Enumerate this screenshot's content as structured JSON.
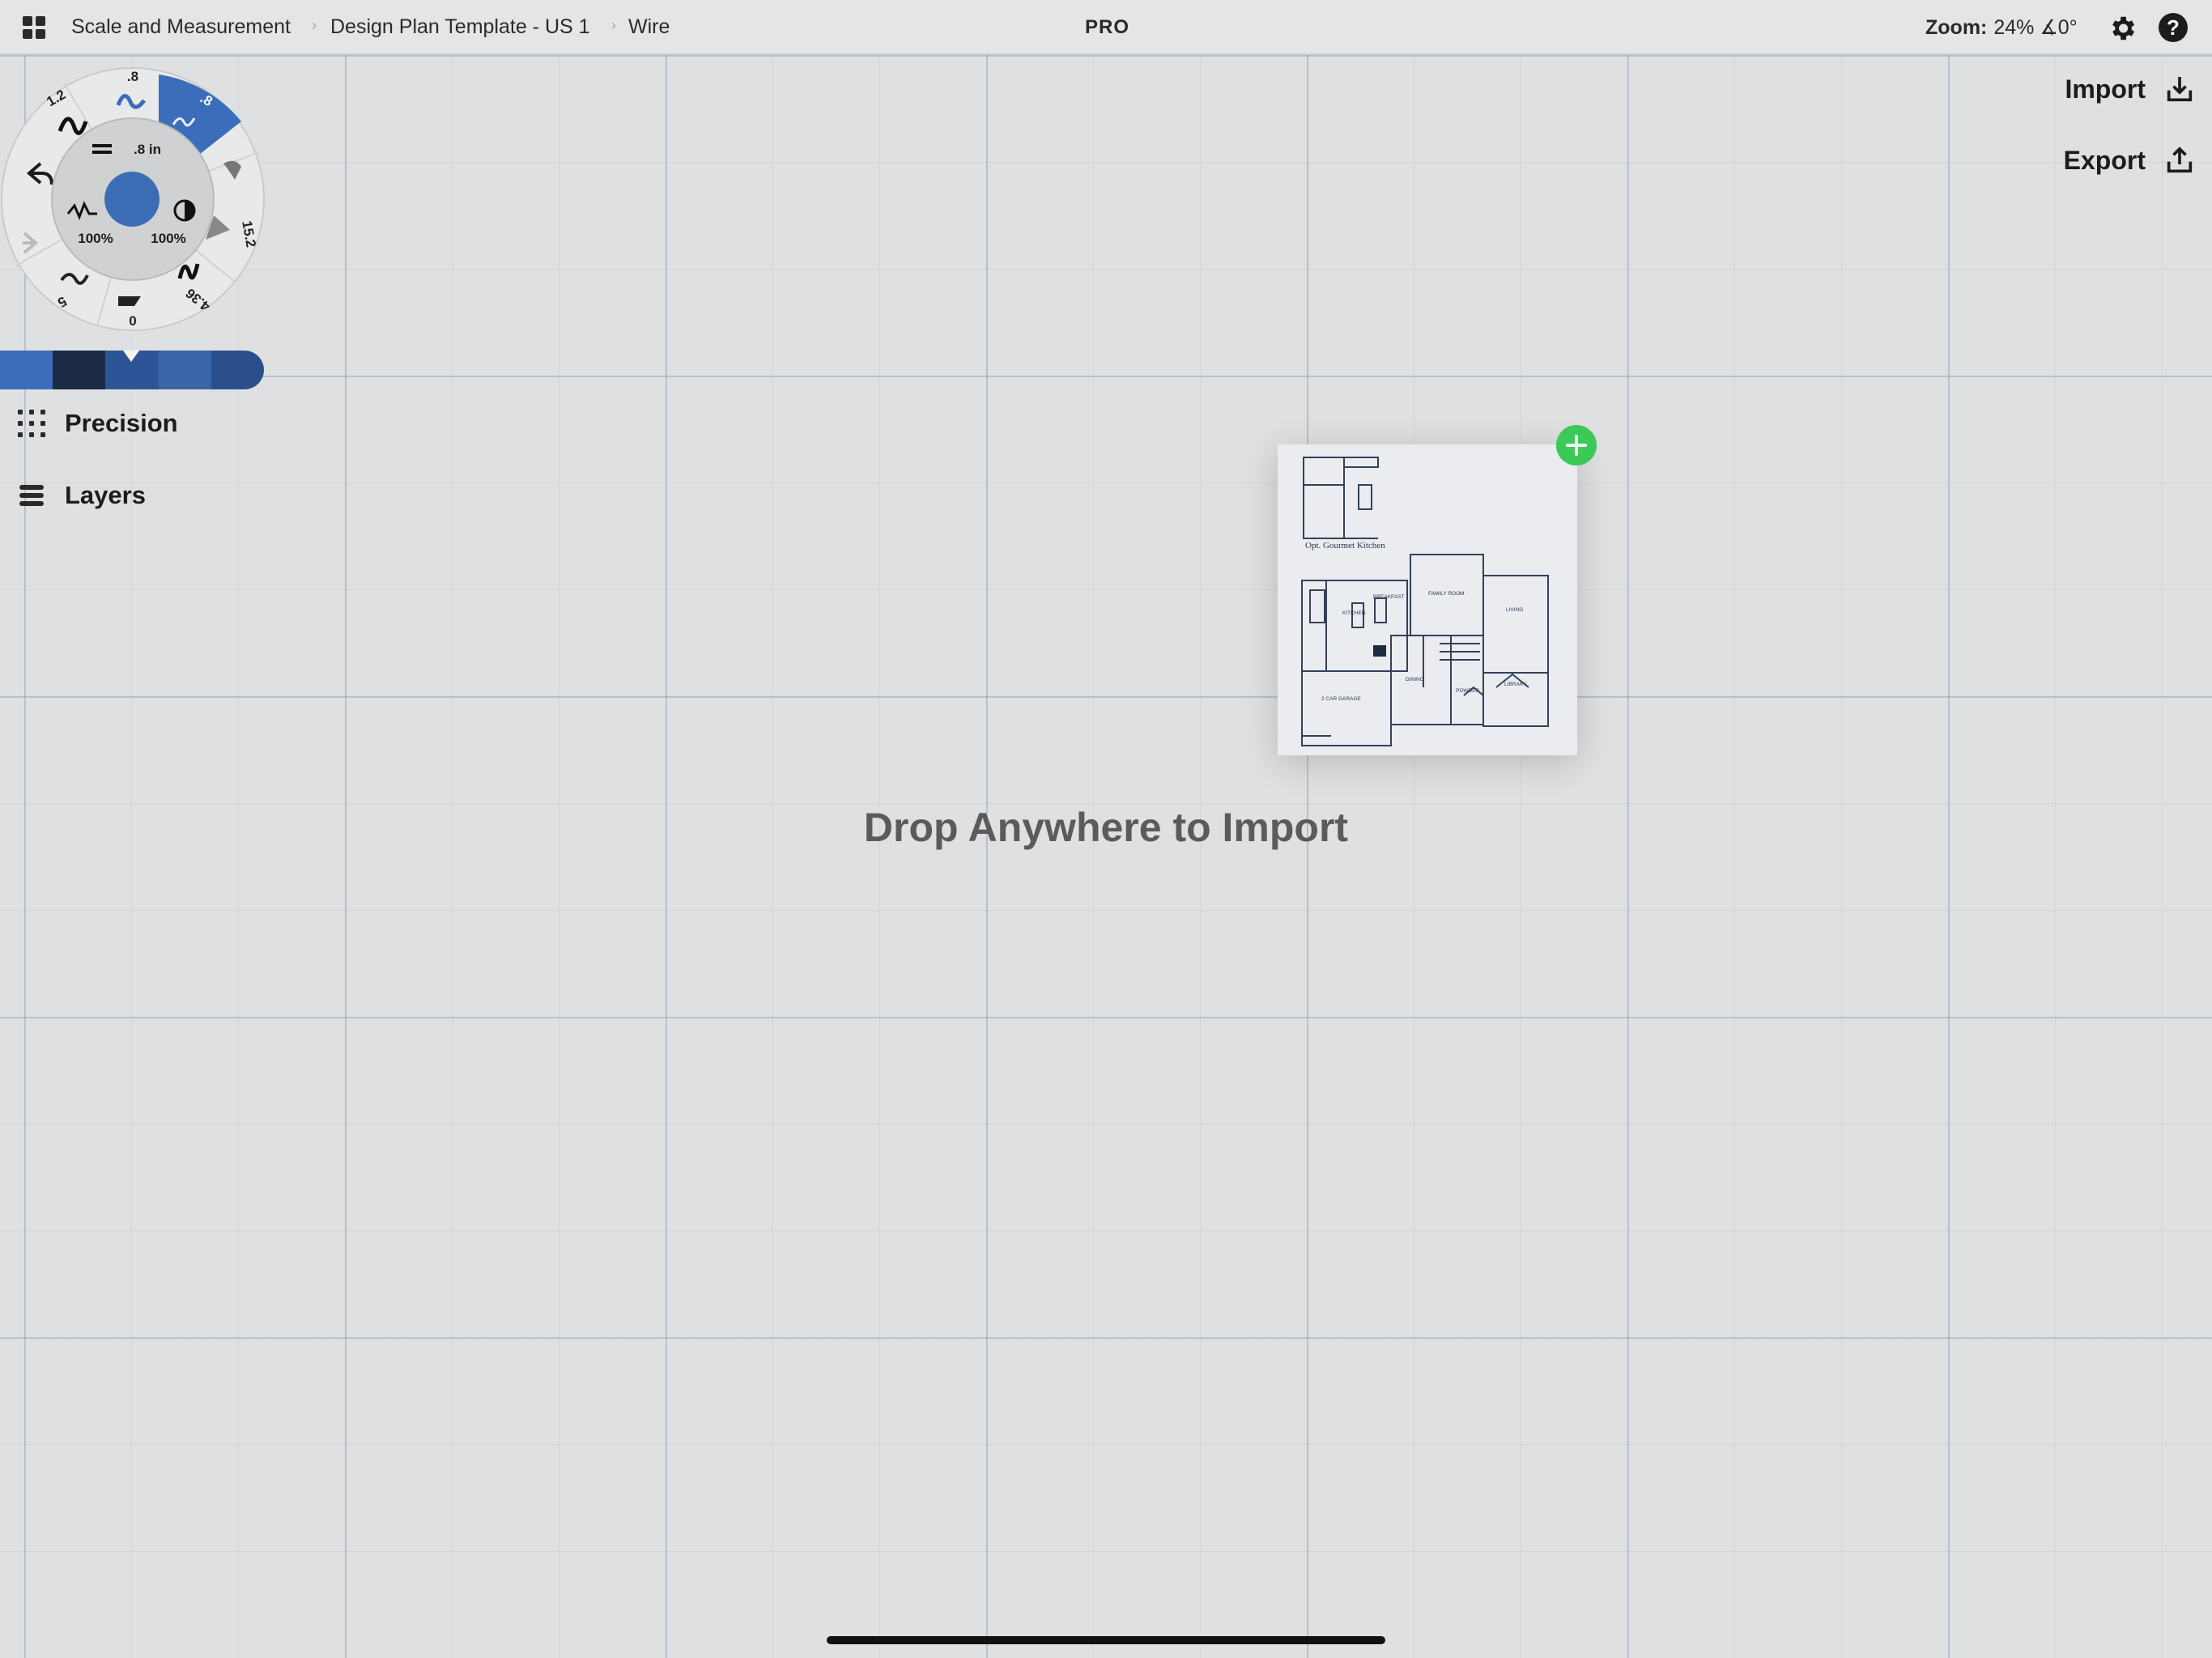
{
  "topbar": {
    "breadcrumbs": [
      "Scale and Measurement",
      "Design Plan Template - US 1",
      "Wire"
    ],
    "pro_label": "PRO",
    "zoom_label": "Zoom:",
    "zoom_value": "24% ∡0°",
    "settings_icon": "gear-icon",
    "help_label": "?"
  },
  "actions": {
    "import_label": "Import",
    "export_label": "Export"
  },
  "tool_wheel": {
    "brush_sizes": [
      ".8",
      ".8",
      "1.2",
      "15.2",
      "4.36",
      "5"
    ],
    "size_label": ".8 in",
    "opacity_left": "100%",
    "opacity_right": "100%",
    "bottom_value": "0",
    "current_color": "#3b6db5"
  },
  "palette": {
    "colors": [
      "#3c6dba",
      "#1b2a45",
      "#2d5497",
      "#3a66a8",
      "#2a4f8a"
    ]
  },
  "left_menu": {
    "precision_label": "Precision",
    "layers_label": "Layers"
  },
  "canvas": {
    "drop_message": "Drop Anywhere to Import",
    "plan_caption": "Opt. Gourmet Kitchen",
    "plan_rooms": [
      "BREAKFAST",
      "FAMILY ROOM",
      "LIVING",
      "KITCHEN",
      "DINING",
      "POWDER",
      "LIBRARY",
      "2 CAR GARAGE"
    ]
  }
}
